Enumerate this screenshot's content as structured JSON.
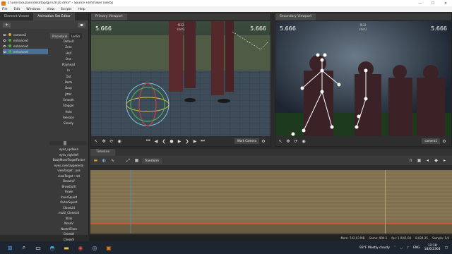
{
  "window": {
    "title": "c:\\users\\ouzarv\\desktop\\giri\\2h10.dmx* - Source Filmmaker [Beta]",
    "min": "—",
    "max": "☐",
    "close": "✕"
  },
  "menu": [
    "File",
    "Edit",
    "Windows",
    "View",
    "Scripts",
    "Help"
  ],
  "left_panel": {
    "tabs": [
      "Element Viewer",
      "Animation Set Editor"
    ],
    "add_label": "+",
    "anim_sets": [
      {
        "label": "camera1"
      },
      {
        "label": "enhanced"
      },
      {
        "label": "enhanced"
      },
      {
        "label": "enhanced"
      }
    ],
    "proc_tabs": [
      "Procedural",
      "LerStr"
    ],
    "procedural": [
      "Default",
      "Zero",
      "Half",
      "One",
      "Playhead",
      "In",
      "Out",
      "Paste",
      "Drop",
      "Jitter",
      "Smooth",
      "Stagger",
      "Hold",
      "Release",
      "Steady"
    ],
    "flex_controls": [
      "eyes_updown",
      "eyes_rightleft",
      "BodyMoveTargetFactor",
      "eyes_overlaygeneral",
      "viewTarget : pos",
      "viewTarget : rot",
      "BrowInV",
      "BrowOutV",
      "Frown",
      "InnerSquint",
      "OuterSquint",
      "CloseLid",
      "multi_CloseLid",
      "blink",
      "NoseV",
      "NostrilFlare",
      "CheekH",
      "CheekV"
    ]
  },
  "primary_viewport": {
    "tab": "Primary Viewport",
    "fps_left": "5.666",
    "fps_right": "5.666",
    "frame": "f632",
    "shot": "shot1",
    "camera_button": "Work Camera"
  },
  "secondary_viewport": {
    "tab": "Secondary Viewport",
    "fps_left": "5.666",
    "fps_right": "5.666",
    "frame": "f632",
    "shot": "shot1",
    "camera_button": "camera1"
  },
  "timeline": {
    "tab": "Timeline",
    "transform_label": "Transform"
  },
  "status_bar": {
    "mem": "Mem: 742.03 MB",
    "game": "Game: 904.1",
    "fps": "fps: 1.00/1.00",
    "sample": "8,024.25",
    "samples": "Sample: 1/4"
  },
  "taskbar": {
    "weather": "93°F Mostly cloudy",
    "lang": "ENG",
    "time": "12:18",
    "date": "18/6/2364"
  },
  "colors": {
    "accent": "#4b6e91",
    "timeline_track": "#8a7a55",
    "playhead_line": "#d04a2a"
  }
}
